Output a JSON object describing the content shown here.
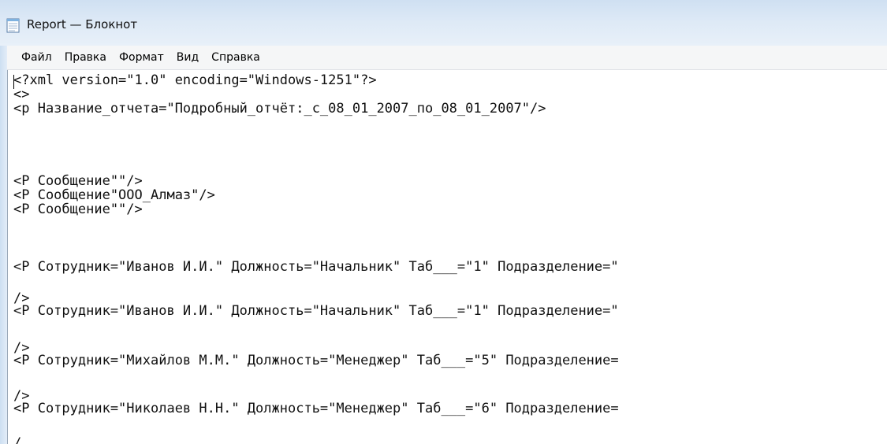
{
  "window": {
    "title": "Report — Блокнот",
    "icon": "notepad-icon"
  },
  "menu": {
    "items": [
      "Файл",
      "Правка",
      "Формат",
      "Вид",
      "Справка"
    ]
  },
  "editor": {
    "lines": [
      "<?xml version=\"1.0\" encoding=\"Windows-1251\"?>",
      "<>",
      "<p Название_отчета=\"Подробный_отчёт:_с_08_01_2007_по_08_01_2007\"/>",
      "<P Сообщение\"\"/>",
      "<P Сообщение\"ООО_Алмаз\"/>",
      "<P Сообщение\"\"/>",
      "<P Сотрудник=\"Иванов И.И.\" Должность=\"Начальник\" Таб___=\"1\" Подразделение=\"",
      "/>",
      "<P Сотрудник=\"Иванов И.И.\" Должность=\"Начальник\" Таб___=\"1\" Подразделение=\"",
      "/>",
      "<P Сотрудник=\"Михайлов М.М.\" Должность=\"Менеджер\" Таб___=\"5\" Подразделение=",
      "/>",
      "<P Сотрудник=\"Николаев Н.Н.\" Должность=\"Менеджер\" Таб___=\"6\" Подразделение=",
      "/"
    ]
  }
}
